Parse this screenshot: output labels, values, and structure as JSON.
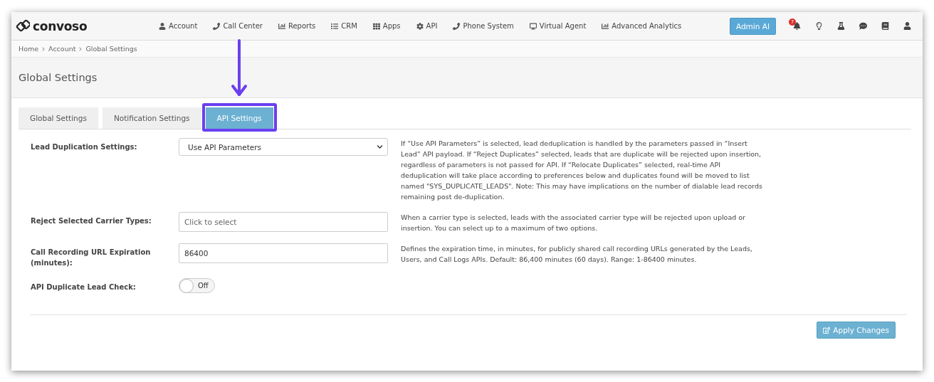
{
  "nav": {
    "logo": "convoso",
    "items": [
      "Account",
      "Call Center",
      "Reports",
      "CRM",
      "Apps",
      "API",
      "Phone System",
      "Virtual Agent",
      "Advanced Analytics"
    ],
    "admin_button": "Admin AI",
    "notification_count": "7"
  },
  "breadcrumb": [
    "Home",
    "Account",
    "Global Settings"
  ],
  "page_title": "Global Settings",
  "tabs": [
    {
      "label": "Global Settings",
      "selected": false
    },
    {
      "label": "Notification Settings",
      "selected": false
    },
    {
      "label": "API Settings",
      "selected": true
    }
  ],
  "settings": [
    {
      "kind": "select",
      "label": "Lead Duplication Settings:",
      "value": "Use API Parameters",
      "help": "If “Use API Parameters” is selected, lead deduplication is handled by the parameters passed in “Insert Lead” API payload. If “Reject Duplicates” selected, leads that are duplicate will be rejected upon insertion, regardless of parameters is not passed for API. If “Relocate Duplicates” selected, real-time API deduplication will take place according to preferences below and duplicates found will be moved to list named \"SYS_DUPLICATE_LEADS\". Note: This may have implications on the number of dialable lead records remaining post de-duplication."
    },
    {
      "kind": "input",
      "label": "Reject Selected Carrier Types:",
      "placeholder": "Click to select",
      "help": "When a carrier type is selected, leads with the associated carrier type will be rejected upon upload or insertion. You can select up to a maximum of two options."
    },
    {
      "kind": "input",
      "label": "Call Recording URL Expiration (minutes):",
      "value": "86400",
      "help": "Defines the expiration time, in minutes, for publicly shared call recording URLs generated by the Leads, Users, and Call Logs APIs. Default: 86,400 minutes (60 days). Range: 1-86400 minutes."
    },
    {
      "kind": "toggle",
      "label": "API Duplicate Lead Check:",
      "on": false,
      "state_label": "Off"
    }
  ],
  "apply_button": "Apply Changes"
}
